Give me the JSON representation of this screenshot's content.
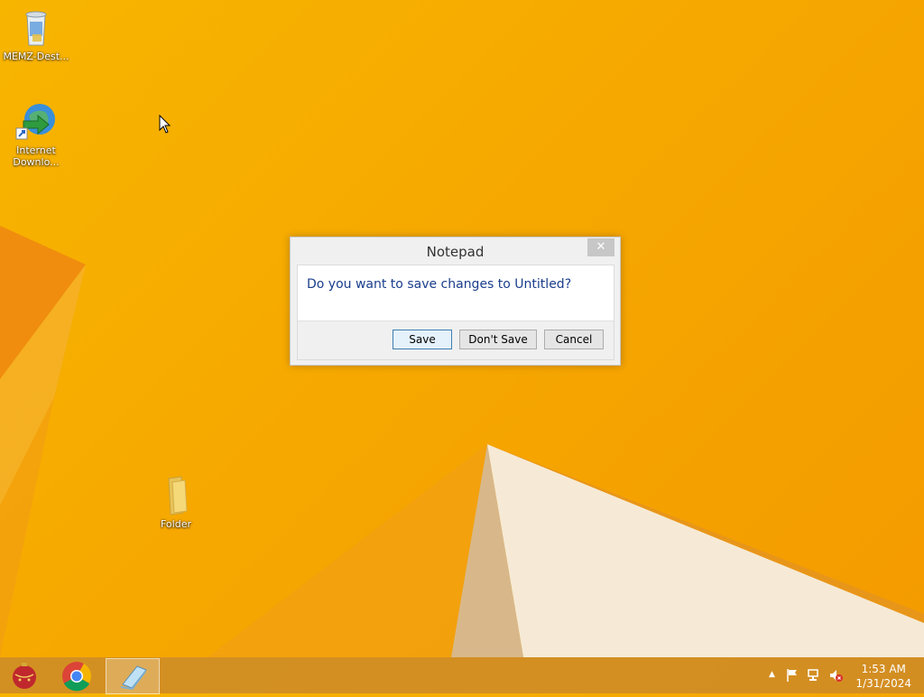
{
  "desktop": {
    "icons": [
      {
        "label": "MEMZ-Dest...",
        "icon": "recycle-bin-icon"
      },
      {
        "label": "Internet Downlo...",
        "icon": "internet-download-manager-icon"
      },
      {
        "label": "Folder",
        "icon": "folder-icon"
      }
    ]
  },
  "dialog": {
    "title": "Notepad",
    "close_glyph": "✕",
    "message": "Do you want to save changes to Untitled?",
    "buttons": {
      "save": "Save",
      "dont_save": "Don't Save",
      "cancel": "Cancel"
    }
  },
  "taskbar": {
    "apps": [
      {
        "icon": "ornament-app-icon"
      },
      {
        "icon": "chrome-icon"
      },
      {
        "icon": "notepad-icon",
        "active": true
      }
    ],
    "tray": {
      "show_hidden_glyph": "▲",
      "time": "1:53 AM",
      "date": "1/31/2024"
    }
  },
  "colors": {
    "wallpaper": "#f7b500",
    "dialog_text": "#1a3e8c",
    "taskbar": "#cd8c28"
  }
}
